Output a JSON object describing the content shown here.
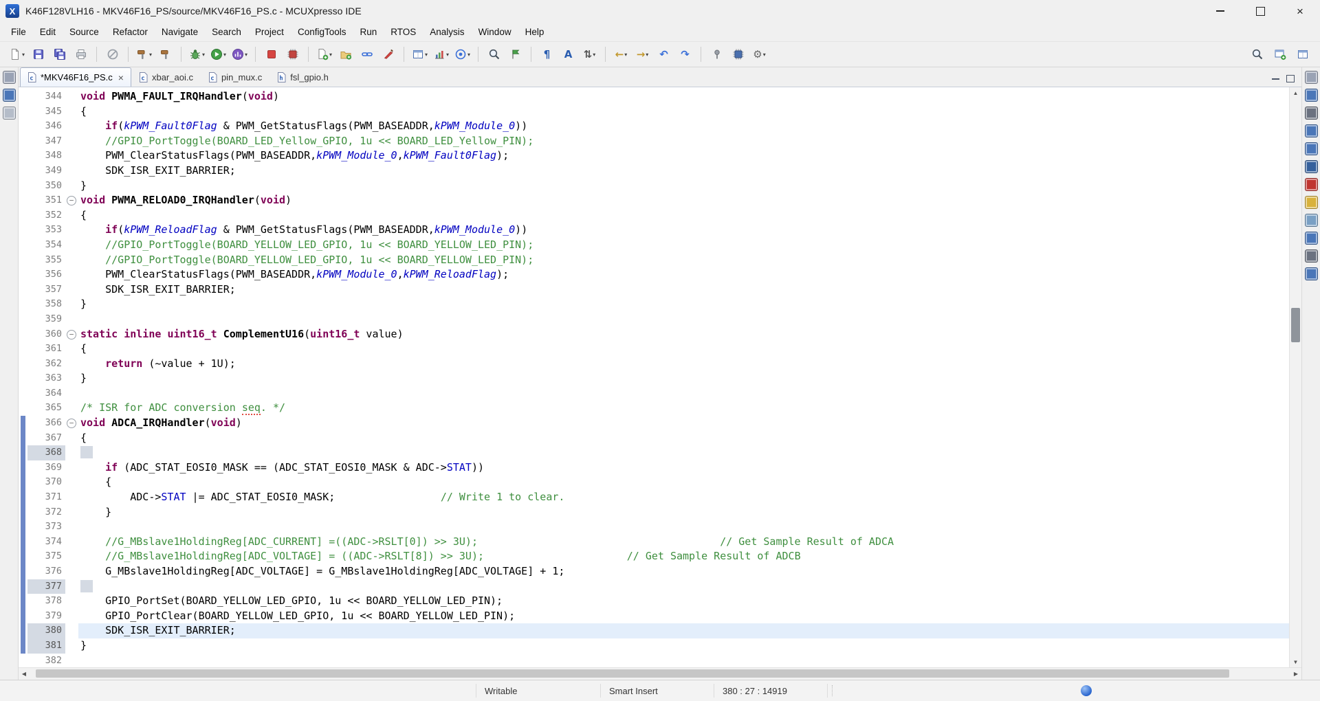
{
  "colors": {
    "keyword": "#7f0055",
    "comment": "#3f8f3f",
    "enum_constant": "#0000c0",
    "field": "#0000c0",
    "current_line": "#e3eefb",
    "change_bar": "#6c87c7",
    "gutter_highlight": "#d4dae3",
    "accent_blue": "#2a66cf"
  },
  "window": {
    "title": "K46F128VLH16 - MKV46F16_PS/source/MKV46F16_PS.c - MCUXpresso IDE",
    "app_icon_letter": "X"
  },
  "menubar": {
    "items": [
      "File",
      "Edit",
      "Source",
      "Refactor",
      "Navigate",
      "Search",
      "Project",
      "ConfigTools",
      "Run",
      "RTOS",
      "Analysis",
      "Window",
      "Help"
    ]
  },
  "toolbar": {
    "dropdown_glyph": "▾",
    "groups": [
      [
        {
          "name": "new-wizard",
          "kind": "page",
          "dd": true
        },
        {
          "name": "save",
          "kind": "floppy"
        },
        {
          "name": "save-all",
          "kind": "floppies"
        },
        {
          "name": "print",
          "kind": "printer"
        }
      ],
      [
        {
          "name": "skip-all-breakpoints",
          "kind": "ban"
        }
      ],
      [
        {
          "name": "build",
          "kind": "hammer",
          "dd": true
        },
        {
          "name": "build-all",
          "kind": "hammer"
        }
      ],
      [
        {
          "name": "debug",
          "kind": "bug",
          "dd": true
        },
        {
          "name": "run",
          "kind": "play",
          "dd": true
        },
        {
          "name": "profile",
          "kind": "profile",
          "dd": true
        }
      ],
      [
        {
          "name": "terminate",
          "kind": "stop"
        },
        {
          "name": "flash-program",
          "kind": "chipRed"
        }
      ],
      [
        {
          "name": "new-source-file",
          "kind": "pagePlus",
          "dd": true
        },
        {
          "name": "new-project",
          "kind": "folderPlus"
        },
        {
          "name": "link-with-editor",
          "kind": "chain"
        },
        {
          "name": "ide-utilities",
          "kind": "knife"
        }
      ],
      [
        {
          "name": "open-element",
          "kind": "grid",
          "dd": true
        },
        {
          "name": "analysis-tools",
          "kind": "chart",
          "dd": true
        },
        {
          "name": "trace",
          "kind": "target",
          "dd": true
        }
      ],
      [
        {
          "name": "search",
          "kind": "mag"
        },
        {
          "name": "bookmark",
          "kind": "flag"
        }
      ],
      [
        {
          "name": "show-whitespace",
          "kind": "para"
        },
        {
          "name": "format-source",
          "kind": "penA"
        },
        {
          "name": "sort-members",
          "kind": "sort",
          "dd": true
        }
      ],
      [
        {
          "name": "back",
          "kind": "arrowL",
          "dd": true
        },
        {
          "name": "forward",
          "kind": "arrowR",
          "dd": true
        },
        {
          "name": "undo",
          "kind": "undo"
        },
        {
          "name": "redo",
          "kind": "redo"
        }
      ],
      [
        {
          "name": "pin-editor",
          "kind": "pin"
        },
        {
          "name": "device-configuration",
          "kind": "chipBlue"
        },
        {
          "name": "settings",
          "kind": "gear",
          "dd": true
        }
      ]
    ],
    "right": [
      {
        "name": "toolbar-search",
        "kind": "mag"
      },
      {
        "name": "open-perspective",
        "kind": "gridPlus"
      },
      {
        "name": "develop-perspective",
        "kind": "grid"
      }
    ]
  },
  "tabs": {
    "close_glyph": "×",
    "items": [
      {
        "label": "*MKV46F16_PS.c",
        "kind": "c",
        "active": true
      },
      {
        "label": "xbar_aoi.c",
        "kind": "c",
        "active": false
      },
      {
        "label": "pin_mux.c",
        "kind": "c",
        "active": false
      },
      {
        "label": "fsl_gpio.h",
        "kind": "h",
        "active": false
      }
    ]
  },
  "left_strip": [
    {
      "name": "restore-left-view",
      "color": "#9aa3b5"
    },
    {
      "name": "project-explorer-min",
      "color": "#4a76b8"
    },
    {
      "name": "peripherals-min",
      "color": "#b5bdc9"
    }
  ],
  "right_strip": [
    {
      "name": "restore-right-view",
      "color": "#9aa3b5"
    },
    {
      "name": "outline-view-min",
      "color": "#4a76b8"
    },
    {
      "name": "terminal-view-min",
      "color": "#6b7280"
    },
    {
      "name": "memory-view-min",
      "color": "#4a76b8"
    },
    {
      "name": "heap-stack-view-min",
      "color": "#4a76b8"
    },
    {
      "name": "registers-view-min",
      "color": "#35609c"
    },
    {
      "name": "faults-view-min",
      "color": "#c03530"
    },
    {
      "name": "peripherals-view-min",
      "color": "#d8b23c"
    },
    {
      "name": "power-view-min",
      "color": "#7aa0c4"
    },
    {
      "name": "swo-view-min",
      "color": "#4a76b8"
    },
    {
      "name": "problems-view-min",
      "color": "#6b7280"
    },
    {
      "name": "console-view-min",
      "color": "#4a76b8"
    }
  ],
  "editor": {
    "fold_glyph": "−",
    "lines": [
      {
        "n": 344,
        "parts": [
          [
            "k",
            "void"
          ],
          [
            "p",
            " "
          ],
          [
            "fn",
            "PWMA_FAULT_IRQHandler"
          ],
          [
            "p",
            "("
          ],
          [
            "k",
            "void"
          ],
          [
            "p",
            ")"
          ]
        ]
      },
      {
        "n": 345,
        "parts": [
          [
            "p",
            "{"
          ]
        ]
      },
      {
        "n": 346,
        "parts": [
          [
            "p",
            "    "
          ],
          [
            "k",
            "if"
          ],
          [
            "p",
            "("
          ],
          [
            "e",
            "kPWM_Fault0Flag"
          ],
          [
            "p",
            " & PWM_GetStatusFlags(PWM_BASEADDR,"
          ],
          [
            "e",
            "kPWM_Module_0"
          ],
          [
            "p",
            "))"
          ]
        ]
      },
      {
        "n": 347,
        "parts": [
          [
            "p",
            "    "
          ],
          [
            "c",
            "//GPIO_PortToggle(BOARD_LED_Yellow_GPIO, 1u << BOARD_LED_Yellow_PIN);"
          ]
        ]
      },
      {
        "n": 348,
        "parts": [
          [
            "p",
            "    PWM_ClearStatusFlags(PWM_BASEADDR,"
          ],
          [
            "e",
            "kPWM_Module_0"
          ],
          [
            "p",
            ","
          ],
          [
            "e",
            "kPWM_Fault0Flag"
          ],
          [
            "p",
            ");"
          ]
        ]
      },
      {
        "n": 349,
        "parts": [
          [
            "p",
            "    SDK_ISR_EXIT_BARRIER;"
          ]
        ]
      },
      {
        "n": 350,
        "parts": [
          [
            "p",
            "}"
          ]
        ]
      },
      {
        "n": 351,
        "fold": true,
        "parts": [
          [
            "k",
            "void"
          ],
          [
            "p",
            " "
          ],
          [
            "fn",
            "PWMA_RELOAD0_IRQHandler"
          ],
          [
            "p",
            "("
          ],
          [
            "k",
            "void"
          ],
          [
            "p",
            ")"
          ]
        ]
      },
      {
        "n": 352,
        "parts": [
          [
            "p",
            "{"
          ]
        ]
      },
      {
        "n": 353,
        "parts": [
          [
            "p",
            "    "
          ],
          [
            "k",
            "if"
          ],
          [
            "p",
            "("
          ],
          [
            "e",
            "kPWM_ReloadFlag"
          ],
          [
            "p",
            " & PWM_GetStatusFlags(PWM_BASEADDR,"
          ],
          [
            "e",
            "kPWM_Module_0"
          ],
          [
            "p",
            "))"
          ]
        ]
      },
      {
        "n": 354,
        "parts": [
          [
            "p",
            "    "
          ],
          [
            "c",
            "//GPIO_PortToggle(BOARD_YELLOW_LED_GPIO, 1u << BOARD_YELLOW_LED_PIN);"
          ]
        ]
      },
      {
        "n": 355,
        "parts": [
          [
            "p",
            "    "
          ],
          [
            "c",
            "//GPIO_PortToggle(BOARD_YELLOW_LED_GPIO, 1u << BOARD_YELLOW_LED_PIN);"
          ]
        ]
      },
      {
        "n": 356,
        "parts": [
          [
            "p",
            "    PWM_ClearStatusFlags(PWM_BASEADDR,"
          ],
          [
            "e",
            "kPWM_Module_0"
          ],
          [
            "p",
            ","
          ],
          [
            "e",
            "kPWM_ReloadFlag"
          ],
          [
            "p",
            ");"
          ]
        ]
      },
      {
        "n": 357,
        "parts": [
          [
            "p",
            "    SDK_ISR_EXIT_BARRIER;"
          ]
        ]
      },
      {
        "n": 358,
        "parts": [
          [
            "p",
            "}"
          ]
        ]
      },
      {
        "n": 359,
        "parts": []
      },
      {
        "n": 360,
        "fold": true,
        "parts": [
          [
            "k",
            "static"
          ],
          [
            "p",
            " "
          ],
          [
            "k",
            "inline"
          ],
          [
            "p",
            " "
          ],
          [
            "k",
            "uint16_t"
          ],
          [
            "p",
            " "
          ],
          [
            "fn",
            "ComplementU16"
          ],
          [
            "p",
            "("
          ],
          [
            "k",
            "uint16_t"
          ],
          [
            "p",
            " value)"
          ]
        ]
      },
      {
        "n": 361,
        "parts": [
          [
            "p",
            "{"
          ]
        ]
      },
      {
        "n": 362,
        "parts": [
          [
            "p",
            "    "
          ],
          [
            "k",
            "return"
          ],
          [
            "p",
            " (~value + 1U);"
          ]
        ]
      },
      {
        "n": 363,
        "parts": [
          [
            "p",
            "}"
          ]
        ]
      },
      {
        "n": 364,
        "parts": []
      },
      {
        "n": 365,
        "parts": [
          [
            "c",
            "/* ISR for ADC conversion "
          ],
          [
            "sp",
            "seq"
          ],
          [
            "c",
            ". */"
          ]
        ]
      },
      {
        "n": 366,
        "fold": true,
        "ch": true,
        "parts": [
          [
            "k",
            "void"
          ],
          [
            "p",
            " "
          ],
          [
            "fn",
            "ADCA_IRQHandler"
          ],
          [
            "p",
            "("
          ],
          [
            "k",
            "void"
          ],
          [
            "p",
            ")"
          ]
        ]
      },
      {
        "n": 367,
        "ch": true,
        "parts": [
          [
            "p",
            "{"
          ]
        ]
      },
      {
        "n": 368,
        "ch": true,
        "gh": true,
        "parts": [
          [
            "w",
            "  "
          ]
        ]
      },
      {
        "n": 369,
        "ch": true,
        "parts": [
          [
            "p",
            "    "
          ],
          [
            "k",
            "if"
          ],
          [
            "p",
            " (ADC_STAT_EOSI0_MASK == (ADC_STAT_EOSI0_MASK & ADC->"
          ],
          [
            "f",
            "STAT"
          ],
          [
            "p",
            "))"
          ]
        ]
      },
      {
        "n": 370,
        "ch": true,
        "parts": [
          [
            "p",
            "    {"
          ]
        ]
      },
      {
        "n": 371,
        "ch": true,
        "parts": [
          [
            "p",
            "        ADC->"
          ],
          [
            "f",
            "STAT"
          ],
          [
            "p",
            " |= ADC_STAT_EOSI0_MASK;"
          ],
          [
            "p",
            "                 "
          ],
          [
            "c",
            "// Write 1 to clear."
          ]
        ]
      },
      {
        "n": 372,
        "ch": true,
        "parts": [
          [
            "p",
            "    }"
          ]
        ]
      },
      {
        "n": 373,
        "ch": true,
        "parts": []
      },
      {
        "n": 374,
        "ch": true,
        "parts": [
          [
            "p",
            "    "
          ],
          [
            "c",
            "//G_MBslave1HoldingReg[ADC_CURRENT] =((ADC->RSLT[0]) >> 3U);"
          ],
          [
            "p",
            "                                       "
          ],
          [
            "c",
            "// Get Sample Result of ADCA"
          ]
        ]
      },
      {
        "n": 375,
        "ch": true,
        "parts": [
          [
            "p",
            "    "
          ],
          [
            "c",
            "//G_MBslave1HoldingReg[ADC_VOLTAGE] = ((ADC->RSLT[8]) >> 3U);"
          ],
          [
            "p",
            "                       "
          ],
          [
            "c",
            "// Get Sample Result of ADCB"
          ]
        ]
      },
      {
        "n": 376,
        "ch": true,
        "parts": [
          [
            "p",
            "    G_MBslave1HoldingReg[ADC_VOLTAGE] = G_MBslave1HoldingReg[ADC_VOLTAGE] + 1;"
          ]
        ]
      },
      {
        "n": 377,
        "ch": true,
        "gh": true,
        "parts": [
          [
            "w",
            "  "
          ]
        ]
      },
      {
        "n": 378,
        "ch": true,
        "parts": [
          [
            "p",
            "    GPIO_PortSet(BOARD_YELLOW_LED_GPIO, 1u << BOARD_YELLOW_LED_PIN);"
          ]
        ]
      },
      {
        "n": 379,
        "ch": true,
        "parts": [
          [
            "p",
            "    GPIO_PortClear(BOARD_YELLOW_LED_GPIO, 1u << BOARD_YELLOW_LED_PIN);"
          ]
        ]
      },
      {
        "n": 380,
        "ch": true,
        "gh": true,
        "hl": true,
        "parts": [
          [
            "p",
            "    SDK_ISR_EXIT_BARRIER;"
          ]
        ]
      },
      {
        "n": 381,
        "ch": true,
        "gh": true,
        "parts": [
          [
            "p",
            "}"
          ]
        ]
      },
      {
        "n": 382,
        "parts": []
      }
    ],
    "token_classes": {
      "k": "keyword",
      "p": "plain",
      "c": "comment",
      "e": "enum-constant",
      "f": "field",
      "fn": "function-name",
      "sp": "misspelled-word",
      "w": "whitespace-highlight"
    }
  },
  "scroll": {
    "v_top_pct": 38,
    "v_height_pct": 6,
    "h_left_pct": 0.5,
    "h_width_pct": 93
  },
  "statusbar": {
    "writable": "Writable",
    "insert_mode": "Smart Insert",
    "position": "380 : 27 : 14919"
  }
}
